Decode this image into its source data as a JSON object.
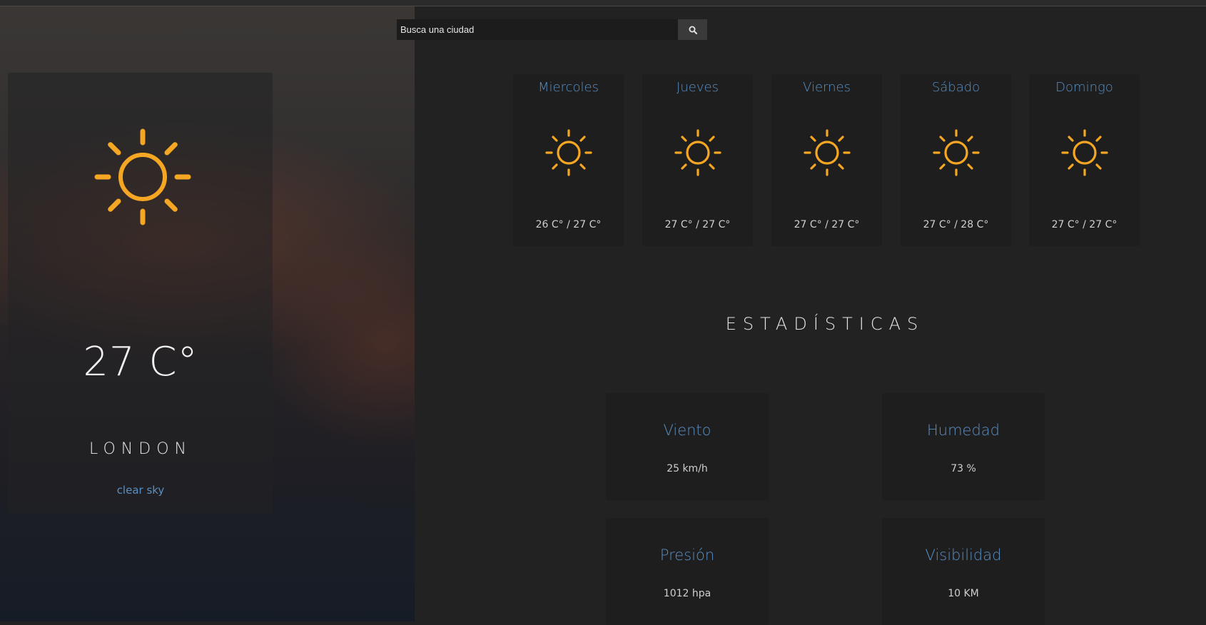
{
  "search": {
    "placeholder": "Busca una ciudad",
    "value": ""
  },
  "current": {
    "icon": "sun-icon",
    "temp": "27 C°",
    "city": "LONDON",
    "description": "clear sky"
  },
  "forecast": [
    {
      "day": "Miercoles",
      "icon": "sun-icon",
      "temps": "26 C° / 27 C°"
    },
    {
      "day": "Jueves",
      "icon": "sun-icon",
      "temps": "27 C° / 27 C°"
    },
    {
      "day": "Viernes",
      "icon": "sun-icon",
      "temps": "27 C° / 27 C°"
    },
    {
      "day": "Sábado",
      "icon": "sun-icon",
      "temps": "27 C° / 28 C°"
    },
    {
      "day": "Domingo",
      "icon": "sun-icon",
      "temps": "27 C° / 27 C°"
    }
  ],
  "stats": {
    "title": "ESTADÍSTICAS",
    "items": [
      {
        "label": "Viento",
        "value": "25 km/h"
      },
      {
        "label": "Humedad",
        "value": "73 %"
      },
      {
        "label": "Presión",
        "value": "1012 hpa"
      },
      {
        "label": "Visibilidad",
        "value": "10 KM"
      }
    ]
  },
  "colors": {
    "accent": "#5b8fc4",
    "sun": "#f5a623",
    "background": "#222222"
  }
}
